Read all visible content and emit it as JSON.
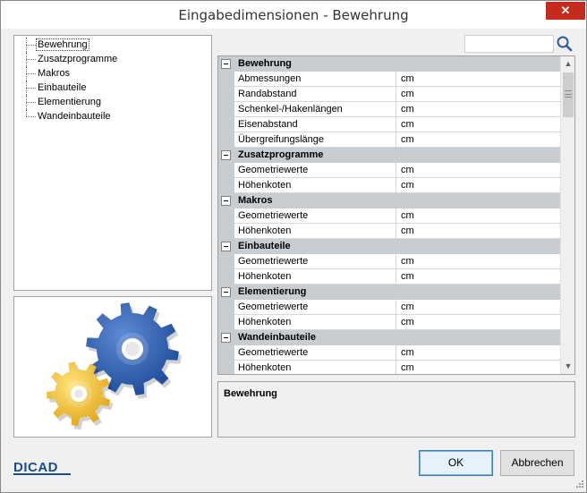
{
  "window": {
    "title": "Eingabedimensionen - Bewehrung",
    "close_label": "✕"
  },
  "tree": {
    "items": [
      {
        "label": "Bewehrung",
        "selected": true
      },
      {
        "label": "Zusatzprogramme"
      },
      {
        "label": "Makros"
      },
      {
        "label": "Einbauteile"
      },
      {
        "label": "Elementierung"
      },
      {
        "label": "Wandeinbauteile"
      }
    ]
  },
  "search": {
    "value": "",
    "icon": "search-icon"
  },
  "grid": {
    "categories": [
      {
        "label": "Bewehrung",
        "toggle": "⊟",
        "rows": [
          {
            "name": "Abmessungen",
            "value": "cm"
          },
          {
            "name": "Randabstand",
            "value": "cm"
          },
          {
            "name": "Schenkel-/Hakenlängen",
            "value": "cm"
          },
          {
            "name": "Eisenabstand",
            "value": "cm"
          },
          {
            "name": "Übergreifungslänge",
            "value": "cm"
          }
        ]
      },
      {
        "label": "Zusatzprogramme",
        "toggle": "⊟",
        "rows": [
          {
            "name": "Geometriewerte",
            "value": "cm"
          },
          {
            "name": "Höhenkoten",
            "value": "cm"
          }
        ]
      },
      {
        "label": "Makros",
        "toggle": "⊟",
        "rows": [
          {
            "name": "Geometriewerte",
            "value": "cm"
          },
          {
            "name": "Höhenkoten",
            "value": "cm"
          }
        ]
      },
      {
        "label": "Einbauteile",
        "toggle": "⊟",
        "rows": [
          {
            "name": "Geometriewerte",
            "value": "cm"
          },
          {
            "name": "Höhenkoten",
            "value": "cm"
          }
        ]
      },
      {
        "label": "Elementierung",
        "toggle": "⊟",
        "rows": [
          {
            "name": "Geometriewerte",
            "value": "cm"
          },
          {
            "name": "Höhenkoten",
            "value": "cm"
          }
        ]
      },
      {
        "label": "Wandeinbauteile",
        "toggle": "⊟",
        "rows": [
          {
            "name": "Geometriewerte",
            "value": "cm"
          },
          {
            "name": "Höhenkoten",
            "value": "cm"
          }
        ]
      }
    ]
  },
  "description": {
    "title": "Bewehrung"
  },
  "logo": {
    "text": "DICAD"
  },
  "buttons": {
    "ok": "OK",
    "cancel": "Abbrechen"
  },
  "colors": {
    "gear_blue": "#2f5fa8",
    "gear_yellow": "#f2c230",
    "category_bg": "#c8cdd1",
    "close_red": "#c42b1c"
  }
}
